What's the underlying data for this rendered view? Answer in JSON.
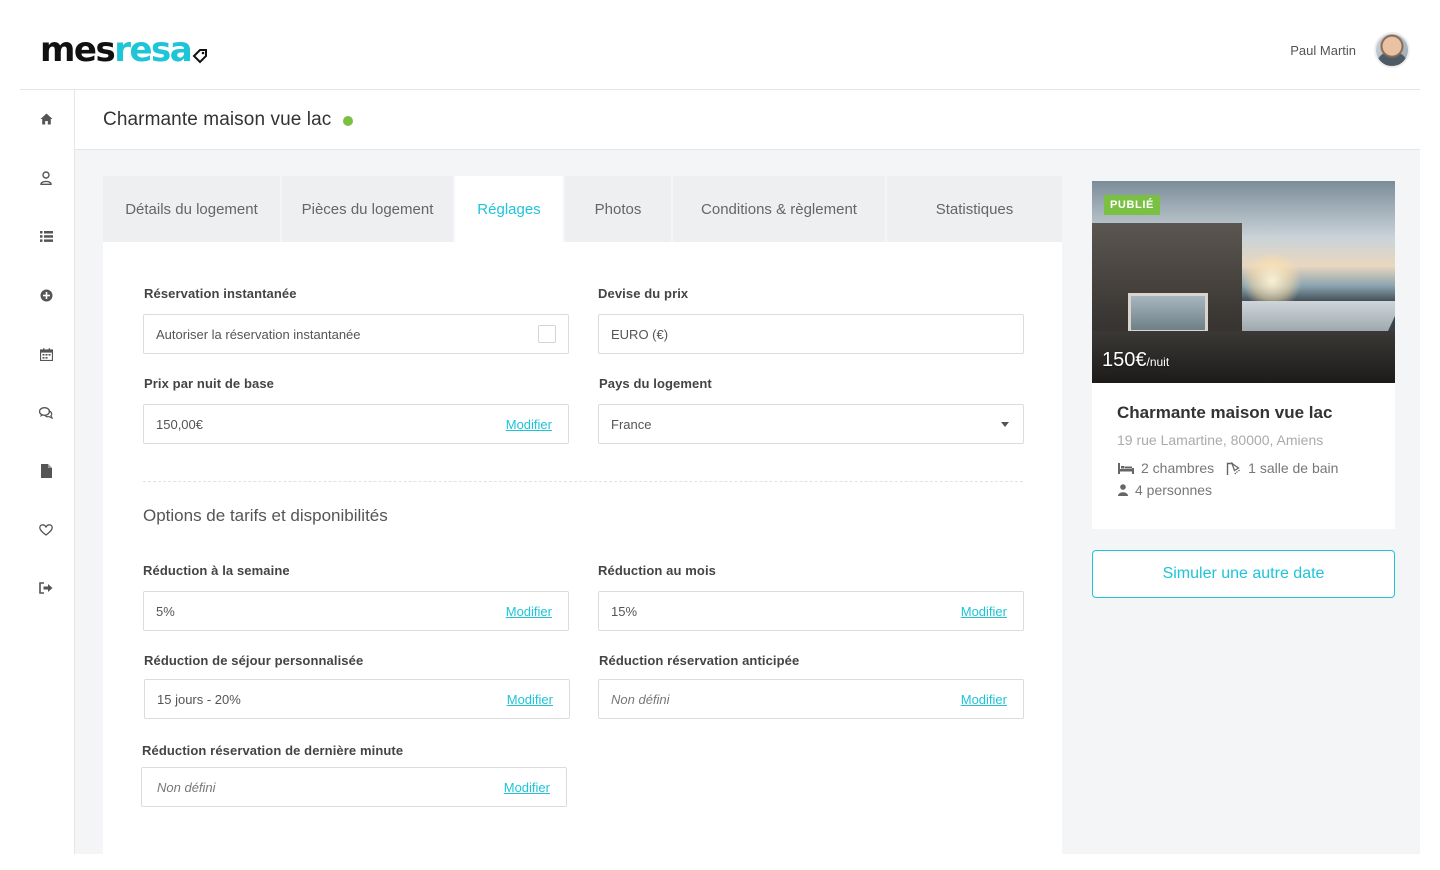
{
  "brand": {
    "logo_part1": "mes",
    "logo_part2": "resa",
    "accent": "#1ec4d8",
    "status_color": "#7ac143"
  },
  "user": {
    "name": "Paul Martin"
  },
  "sidebar": {
    "items": [
      {
        "icon": "home-icon"
      },
      {
        "icon": "user-icon"
      },
      {
        "icon": "list-icon"
      },
      {
        "icon": "add-circle-icon"
      },
      {
        "icon": "calendar-icon"
      },
      {
        "icon": "chat-icon"
      },
      {
        "icon": "document-icon"
      },
      {
        "icon": "heart-icon"
      },
      {
        "icon": "logout-icon"
      }
    ]
  },
  "page": {
    "title": "Charmante maison vue lac",
    "status": "published"
  },
  "tabs": [
    {
      "label": "Détails du logement",
      "active": false
    },
    {
      "label": "Pièces du logement",
      "active": false
    },
    {
      "label": "Réglages",
      "active": true
    },
    {
      "label": "Photos",
      "active": false
    },
    {
      "label": "Conditions & règlement",
      "active": false
    },
    {
      "label": "Statistiques",
      "active": false
    }
  ],
  "form": {
    "instant": {
      "label": "Réservation instantanée",
      "value": "Autoriser la réservation instantanée",
      "checked": false
    },
    "currency": {
      "label": "Devise du prix",
      "value": "EURO (€)"
    },
    "base_price": {
      "label": "Prix par nuit de base",
      "value": "150,00€",
      "action": "Modifier"
    },
    "country": {
      "label": "Pays du logement",
      "value": "France"
    },
    "section_title": "Options de tarifs et disponibilités",
    "weekly": {
      "label": "Réduction à la semaine",
      "value": "5%",
      "action": "Modifier"
    },
    "monthly": {
      "label": "Réduction au mois",
      "value": "15%",
      "action": "Modifier"
    },
    "custom_stay": {
      "label": "Réduction de séjour personnalisée",
      "value": "15 jours - 20%",
      "action": "Modifier"
    },
    "early_booking": {
      "label": "Réduction réservation anticipée",
      "value": "Non défini",
      "action": "Modifier"
    },
    "last_minute": {
      "label": "Réduction réservation de dernière minute",
      "value": "Non défini",
      "action": "Modifier"
    }
  },
  "card": {
    "badge": "PUBLIÉ",
    "price": "150€",
    "price_unit": "/nuit",
    "title": "Charmante maison vue lac",
    "address": "19 rue Lamartine, 80000, Amiens",
    "bedrooms": "2 chambres",
    "bathrooms": "1 salle de bain",
    "guests": "4 personnes"
  },
  "simulate_button": "Simuler une autre date"
}
